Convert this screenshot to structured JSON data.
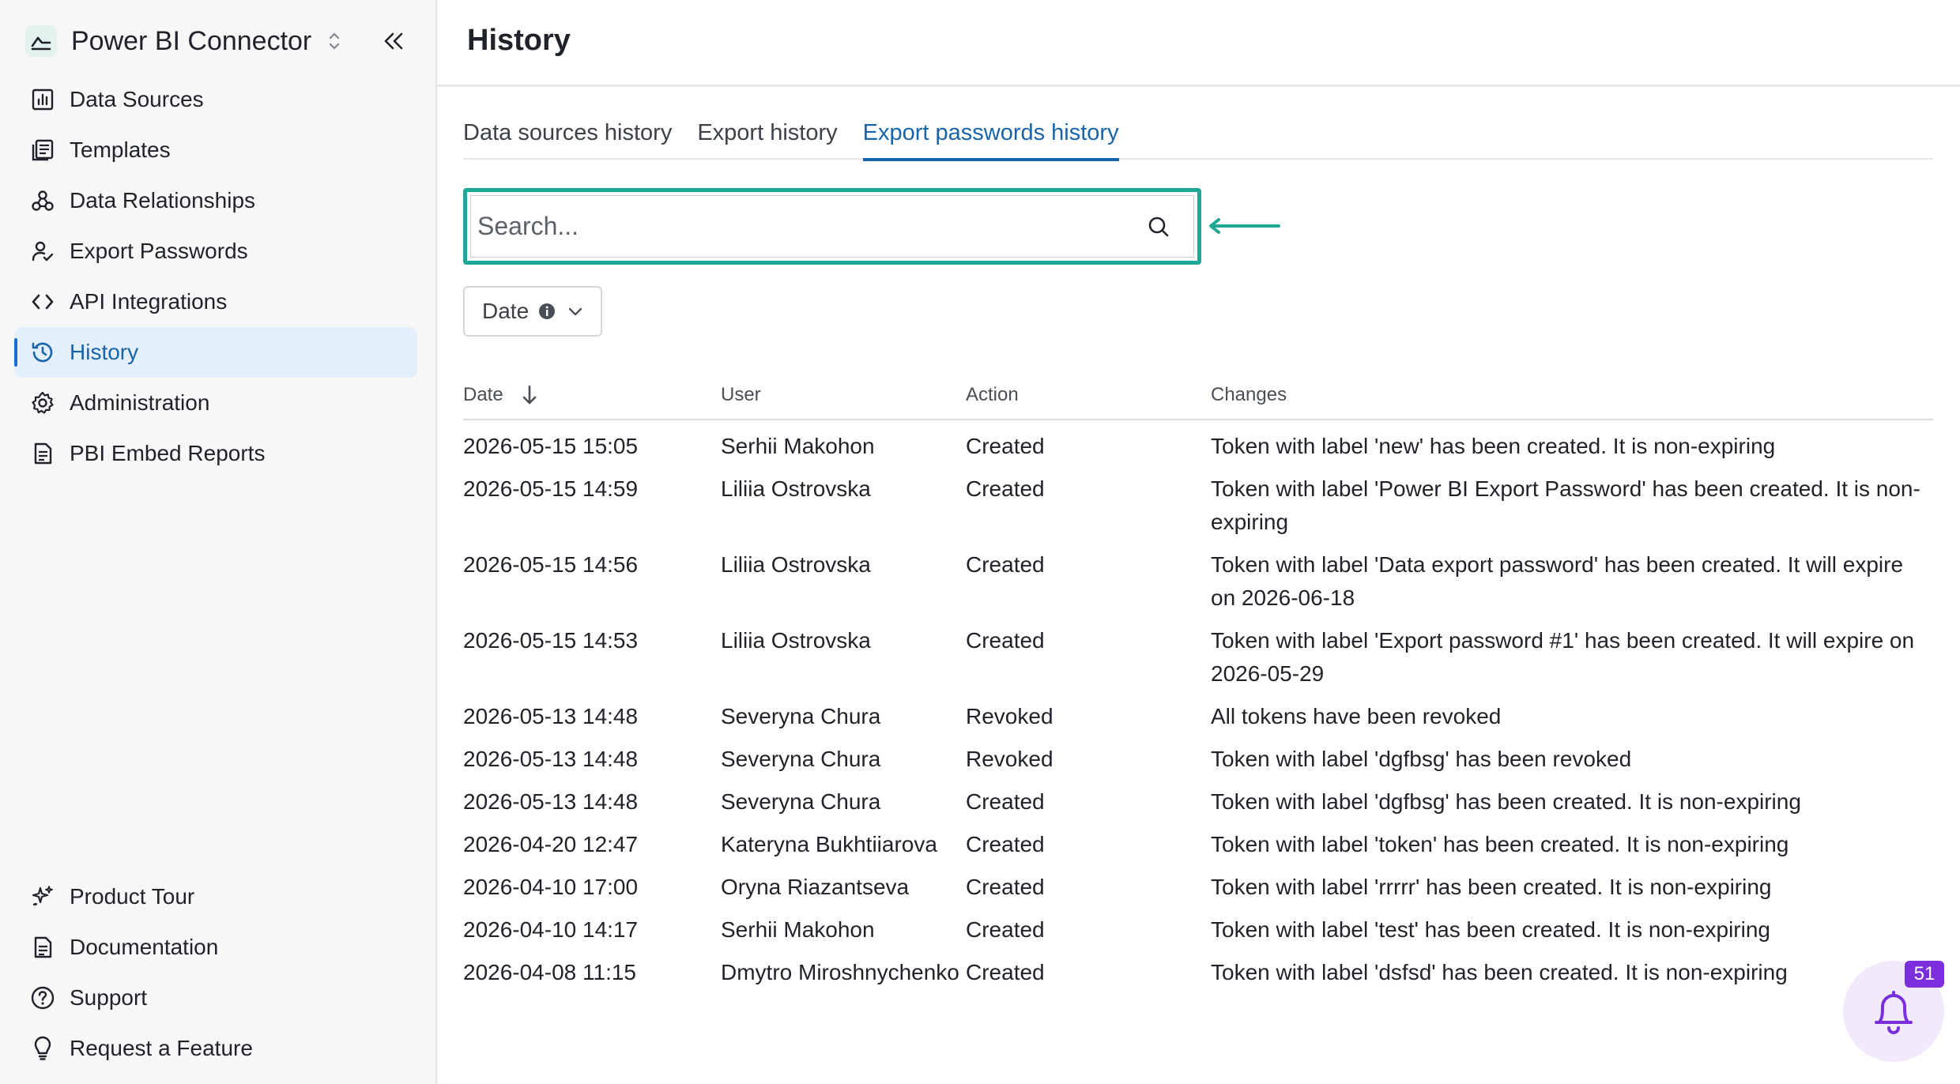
{
  "app": {
    "name": "Power BI Connector",
    "brand_icon": "chart-line-icon"
  },
  "sidebar": {
    "items": [
      {
        "label": "Data Sources",
        "icon": "bar-chart-icon"
      },
      {
        "label": "Templates",
        "icon": "templates-icon"
      },
      {
        "label": "Data Relationships",
        "icon": "relationships-icon"
      },
      {
        "label": "Export Passwords",
        "icon": "user-check-icon"
      },
      {
        "label": "API Integrations",
        "icon": "code-icon"
      },
      {
        "label": "History",
        "icon": "history-icon",
        "active": true
      },
      {
        "label": "Administration",
        "icon": "gear-icon"
      },
      {
        "label": "PBI Embed Reports",
        "icon": "document-icon"
      }
    ],
    "bottom_items": [
      {
        "label": "Product Tour",
        "icon": "sparkles-icon"
      },
      {
        "label": "Documentation",
        "icon": "document-icon"
      },
      {
        "label": "Support",
        "icon": "help-circle-icon"
      },
      {
        "label": "Request a Feature",
        "icon": "lightbulb-icon"
      }
    ]
  },
  "header": {
    "title": "History"
  },
  "tabs": [
    {
      "label": "Data sources history"
    },
    {
      "label": "Export history"
    },
    {
      "label": "Export passwords history",
      "active": true
    }
  ],
  "search": {
    "placeholder": "Search...",
    "value": ""
  },
  "filters": {
    "date_label": "Date"
  },
  "table": {
    "columns": [
      "Date",
      "User",
      "Action",
      "Changes"
    ],
    "sort": {
      "column": "Date",
      "direction": "descending"
    },
    "rows": [
      {
        "date": "2026-05-15 15:05",
        "user": "Serhii Makohon",
        "action": "Created",
        "changes": "Token with label 'new' has been created. It is non-expiring"
      },
      {
        "date": "2026-05-15 14:59",
        "user": "Liliia Ostrovska",
        "action": "Created",
        "changes": "Token with label 'Power BI Export Password' has been created. It is non-expiring"
      },
      {
        "date": "2026-05-15 14:56",
        "user": "Liliia Ostrovska",
        "action": "Created",
        "changes": "Token with label 'Data export password' has been created. It will expire on 2026-06-18"
      },
      {
        "date": "2026-05-15 14:53",
        "user": "Liliia Ostrovska",
        "action": "Created",
        "changes": "Token with label 'Export password #1' has been created. It will expire on 2026-05-29"
      },
      {
        "date": "2026-05-13 14:48",
        "user": "Severyna Chura",
        "action": "Revoked",
        "changes": "All tokens have been revoked"
      },
      {
        "date": "2026-05-13 14:48",
        "user": "Severyna Chura",
        "action": "Revoked",
        "changes": "Token with label 'dgfbsg' has been revoked"
      },
      {
        "date": "2026-05-13 14:48",
        "user": "Severyna Chura",
        "action": "Created",
        "changes": "Token with label 'dgfbsg' has been created. It is non-expiring"
      },
      {
        "date": "2026-04-20 12:47",
        "user": "Kateryna Bukhtiiarova",
        "action": "Created",
        "changes": "Token with label 'token' has been created. It is non-expiring"
      },
      {
        "date": "2026-04-10 17:00",
        "user": "Oryna Riazantseva",
        "action": "Created",
        "changes": "Token with label 'rrrrr' has been created. It is non-expiring"
      },
      {
        "date": "2026-04-10 14:17",
        "user": "Serhii Makohon",
        "action": "Created",
        "changes": "Token with label 'test' has been created. It is non-expiring"
      },
      {
        "date": "2026-04-08 11:15",
        "user": "Dmytro Miroshnychenko",
        "action": "Created",
        "changes": "Token with label 'dsfsd' has been created. It is non-expiring"
      }
    ]
  },
  "notifications": {
    "count": "51",
    "icon": "bell-icon"
  },
  "colors": {
    "accent": "#1864ab",
    "highlight": "#1fa896",
    "active_bg": "#e3effb",
    "badge": "#7b2fdc"
  }
}
